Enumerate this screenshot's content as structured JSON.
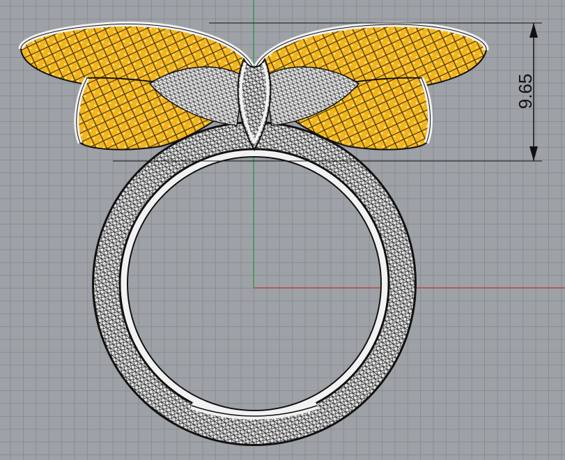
{
  "viewport": {
    "background_color": "#9ea2a7",
    "grid_color": "#878b92",
    "x_axis_color": "#c0392b",
    "y_axis_color": "#1e9e3e",
    "gem_color": "#f3b51c",
    "metal_color": "#f2f2f2",
    "wire_color": "#111111"
  },
  "dimension": {
    "value": "9.65"
  }
}
